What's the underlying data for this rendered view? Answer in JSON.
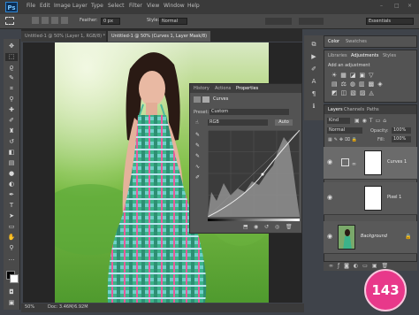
{
  "app": {
    "logo": "Ps"
  },
  "menu": [
    "File",
    "Edit",
    "Image",
    "Layer",
    "Type",
    "Select",
    "Filter",
    "View",
    "Window",
    "Help"
  ],
  "options_bar": {
    "feather_label": "Feather:",
    "feather_value": "0 px",
    "style_label": "Style:",
    "style_value": "Normal",
    "workspace": "Essentials"
  },
  "tabs": [
    {
      "label": "Untitled-1 @ 50% (Layer 1, RGB/8) *"
    },
    {
      "label": "Untitled-1 @ 50% (Curves 1, Layer Mask/8) *"
    }
  ],
  "properties": {
    "tabs": [
      "History",
      "Actions",
      "Properties"
    ],
    "title": "Curves",
    "preset_label": "Preset:",
    "preset_value": "Custom",
    "channel_value": "RGB",
    "auto_label": "Auto"
  },
  "color_panel": {
    "tabs": [
      "Color",
      "Swatches"
    ]
  },
  "adjustments": {
    "tabs": [
      "Libraries",
      "Adjustments",
      "Styles"
    ],
    "subtitle": "Add an adjustment"
  },
  "layers_panel": {
    "tabs": [
      "Layers",
      "Channels",
      "Paths"
    ],
    "kind": "Kind",
    "blend_mode": "Normal",
    "opacity_label": "Opacity:",
    "opacity_value": "100%",
    "fill_label": "Fill:",
    "fill_value": "100%",
    "layers": [
      {
        "name": "Curves 1",
        "thumb_color": "#ffffff"
      },
      {
        "name": "Pixel 1",
        "thumb_color": "#ffffff"
      },
      {
        "name": "Background",
        "thumb_color": "#7aa86a"
      }
    ]
  },
  "status": {
    "zoom": "50%",
    "doc": "Doc: 3.46M/6.92M"
  },
  "page_number": "143",
  "colors": {
    "badge": "#e8388a",
    "panel_bg": "#535353",
    "ui_dark": "#2b2b2b"
  }
}
